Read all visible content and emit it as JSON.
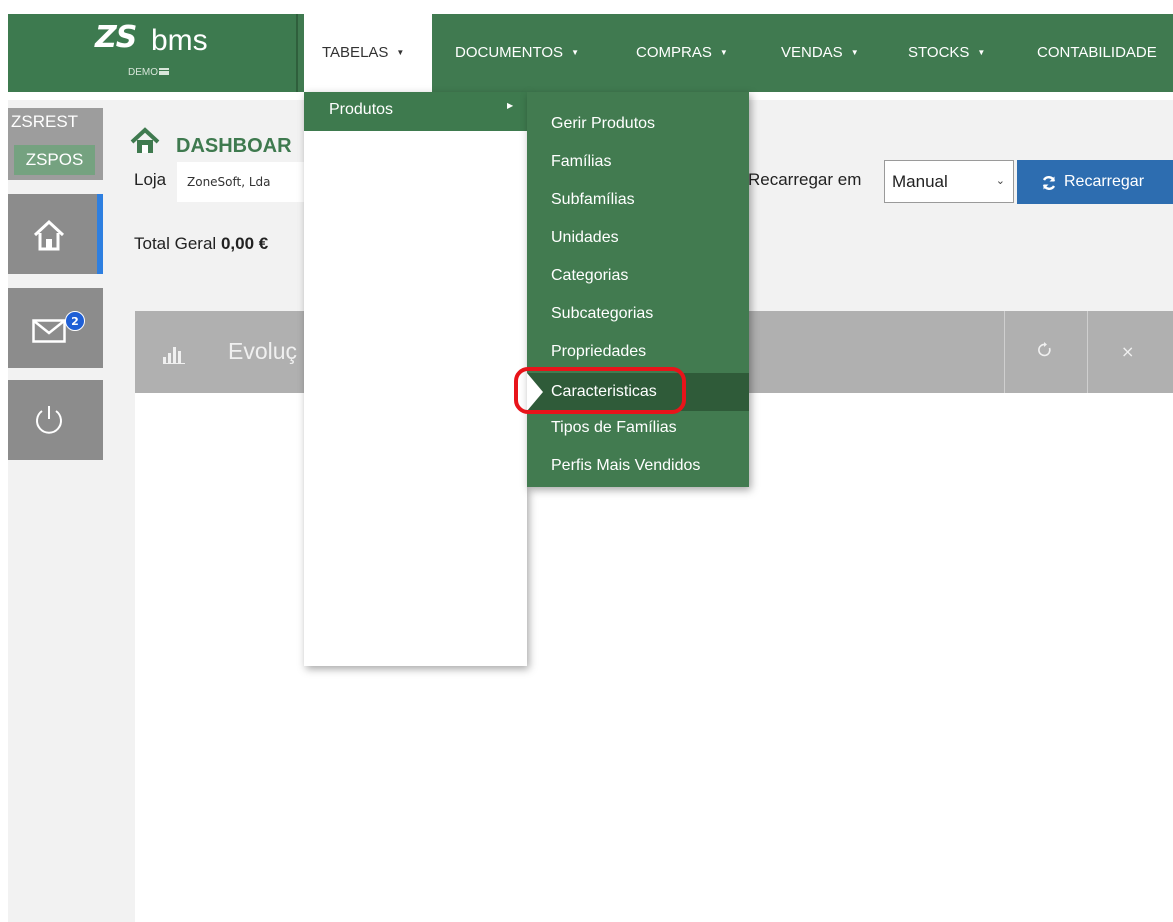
{
  "brand": {
    "logo_mark": "ZS",
    "logo_name": "bms",
    "edition": "DEMO",
    "menu_icon": "hamburger-icon"
  },
  "nav": {
    "items": [
      {
        "label": "TABELAS",
        "active": true
      },
      {
        "label": "DOCUMENTOS",
        "active": false
      },
      {
        "label": "COMPRAS",
        "active": false
      },
      {
        "label": "VENDAS",
        "active": false
      },
      {
        "label": "STOCKS",
        "active": false
      },
      {
        "label": "CONTABILIDADE",
        "active": false
      }
    ],
    "caret_glyph": "▼"
  },
  "sidebar": {
    "products": [
      "ZSREST",
      "ZSPOS"
    ],
    "mail_badge": "2",
    "icons": [
      "home-icon",
      "mail-icon",
      "power-icon"
    ]
  },
  "dashboard": {
    "title": "DASHBOAR",
    "store_label": "Loja",
    "store_value": "ZoneSoft, Lda",
    "total_label": "Total Geral",
    "total_value": "0,00 €",
    "reload_label": "Recarregar em",
    "reload_option": "Manual",
    "reload_button": "Recarregar",
    "panel_title": "Evoluç",
    "panel_close": "×"
  },
  "menu": {
    "level1": [
      {
        "label": "Produtos",
        "submenu_glyph": "▶"
      }
    ],
    "level2": [
      {
        "label": "Gerir Produtos",
        "active": false
      },
      {
        "label": "Famílias",
        "active": false
      },
      {
        "label": "Subfamílias",
        "active": false
      },
      {
        "label": "Unidades",
        "active": false
      },
      {
        "label": "Categorias",
        "active": false
      },
      {
        "label": "Subcategorias",
        "active": false
      },
      {
        "label": "Propriedades",
        "active": false
      },
      {
        "label": "Caracteristicas",
        "active": true
      },
      {
        "label": "Tipos de Famílias",
        "active": false
      },
      {
        "label": "Perfis Mais Vendidos",
        "active": false
      }
    ]
  },
  "colors": {
    "brand_green": "#407a50",
    "menu_active": "#2f5b39",
    "accent_blue": "#2d6db0",
    "highlight_red": "#e8141a"
  }
}
